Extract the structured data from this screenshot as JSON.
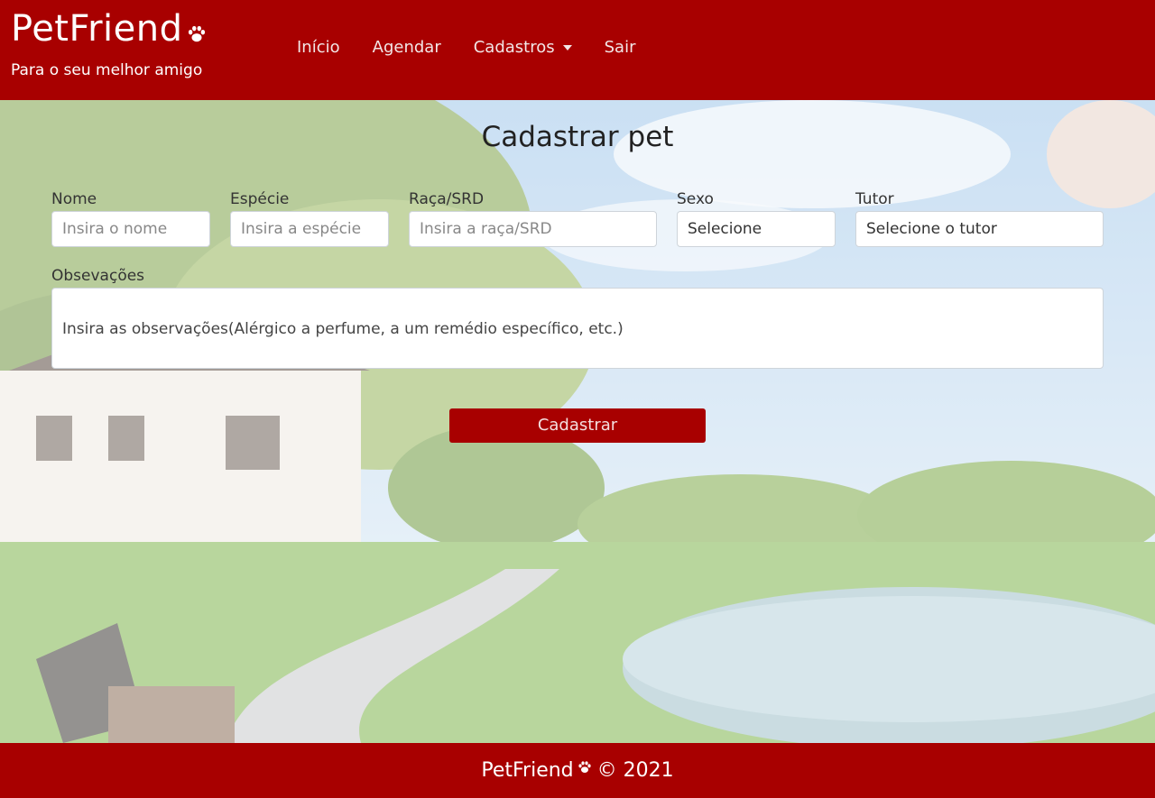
{
  "header": {
    "brand": "PetFriend",
    "tagline": "Para o seu melhor amigo",
    "nav": [
      {
        "label": "Início"
      },
      {
        "label": "Agendar"
      },
      {
        "label": "Cadastros"
      },
      {
        "label": "Sair"
      }
    ]
  },
  "main": {
    "title": "Cadastrar pet",
    "fields": {
      "nome": {
        "label": "Nome",
        "placeholder": "Insira o nome"
      },
      "especie": {
        "label": "Espécie",
        "placeholder": "Insira a espécie"
      },
      "raca": {
        "label": "Raça/SRD",
        "placeholder": "Insira a raça/SRD"
      },
      "sexo": {
        "label": "Sexo",
        "value": "Selecione"
      },
      "tutor": {
        "label": "Tutor",
        "value": "Selecione o tutor"
      },
      "obs": {
        "label": "Obsevações",
        "placeholder": "Insira as observações(Alérgico a perfume, a um remédio específico, etc.)"
      }
    },
    "submit_label": "Cadastrar"
  },
  "footer": {
    "brand": "PetFriend",
    "copyright": "© 2021"
  },
  "colors": {
    "primary": "#a80000",
    "border": "#ced4da"
  },
  "icons": [
    "paw-icon",
    "caret-down-icon"
  ]
}
